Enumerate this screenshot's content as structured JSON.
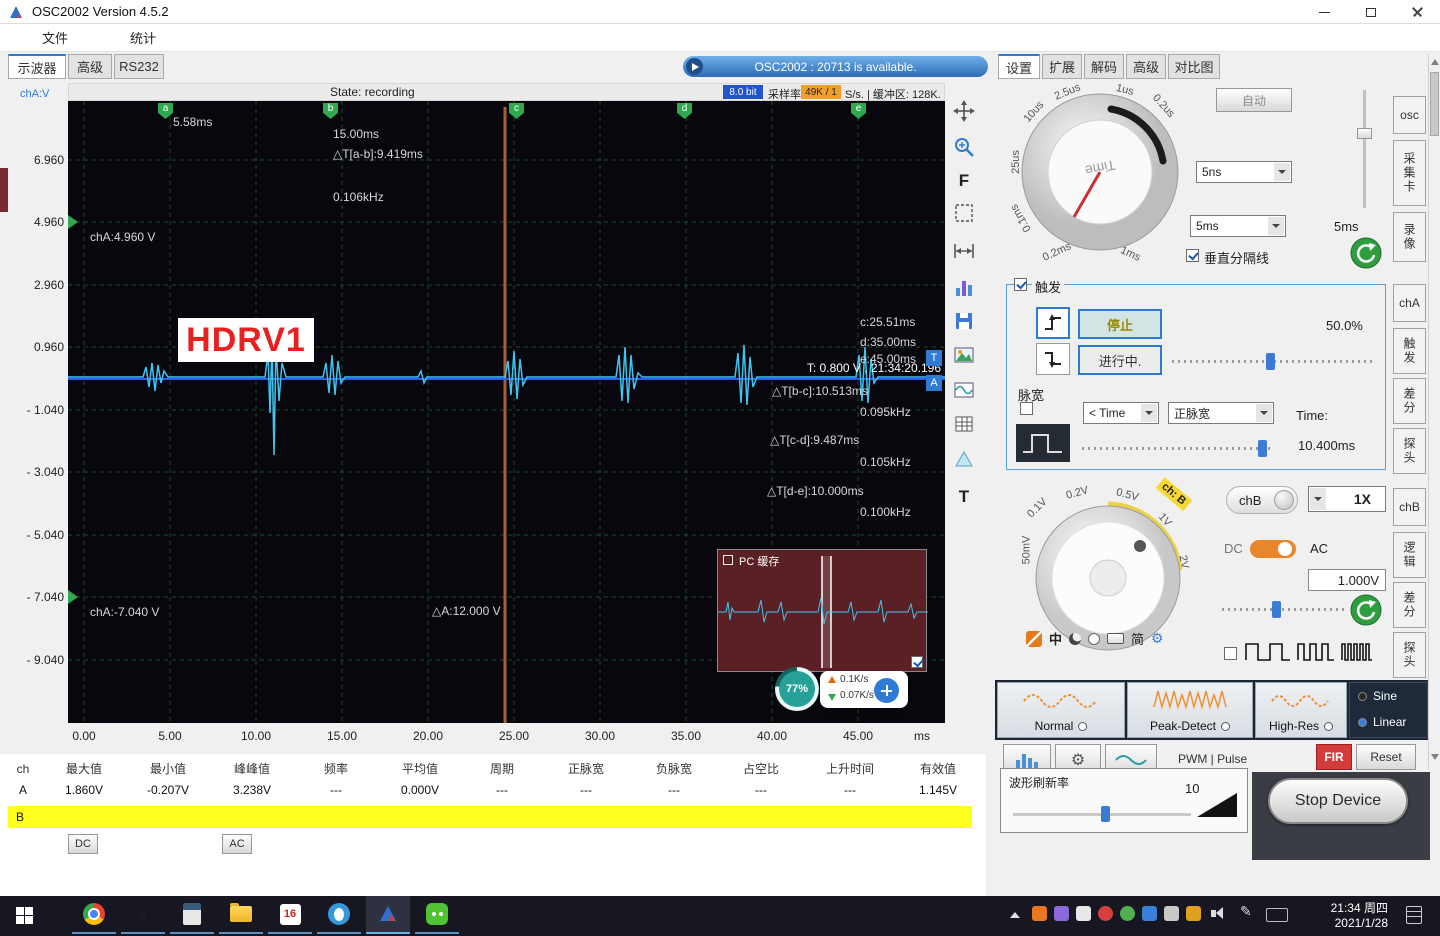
{
  "window": {
    "title": "OSC2002  Version 4.5.2"
  },
  "menubar": {
    "file": "文件",
    "stats": "统计"
  },
  "tabs": {
    "scope": "示波器",
    "advanced": "高级",
    "rs232": "RS232"
  },
  "notification": {
    "text": "OSC2002 : 20713 is available."
  },
  "colors": {
    "accent_blue": "#2e7bd6",
    "waveform_cyan": "#3fc6f0",
    "grid_green": "#1d4d2a",
    "marker_green": "#2fa84f",
    "buffer_maroon": "#5a2026",
    "highlight_yellow": "#ffff1e",
    "badge_orange": "#f0a028",
    "fir_red": "#d43c3c"
  },
  "scope": {
    "state": "State: recording",
    "bits_badge": "8.0 bit",
    "rate_label": "采样率",
    "rate_badge": "49K / 1",
    "rate_suffix": "S/s. | 缓冲区: 128K.",
    "ch_axis": "chA:V",
    "y_ticks": [
      "6.960",
      "4.960",
      "2.960",
      "0.960",
      "- 1.040",
      "- 3.040",
      "- 5.040",
      "- 7.040",
      "- 9.040"
    ],
    "x_ticks": [
      "0.00",
      "5.00",
      "10.00",
      "15.00",
      "20.00",
      "25.00",
      "30.00",
      "35.00",
      "40.00",
      "45.00"
    ],
    "x_unit": "ms",
    "markers": [
      "a",
      "b",
      "c",
      "d",
      "e"
    ],
    "ann": {
      "a_time": "5.58ms",
      "b_time": "15.00ms",
      "dt_ab": "△T[a-b]:9.419ms",
      "f_ab": "0.106kHz",
      "c_time": "c:25.51ms",
      "d_time": "d:35.00ms",
      "e_time": "e:45.00ms",
      "trig": "T: 0.800 V , 21:34:20.196",
      "dt_bc": "△T[b-c]:10.513ms",
      "f_bc": "0.095kHz",
      "dt_cd": "△T[c-d]:9.487ms",
      "f_cd": "0.105kHz",
      "dt_de": "△T[d-e]:10.000ms",
      "f_de": "0.100kHz",
      "ch_top": "chA:4.960 V",
      "ch_bot": "chA:-7.040 V",
      "delta_a": "△A:12.000 V",
      "overlay": "HDRV1",
      "t_flag": "T",
      "a_flag": "A"
    },
    "pc_buffer_label": "PC 缓存",
    "progress": "77%",
    "up_rate": "0.1K/s",
    "down_rate": "0.07K/s"
  },
  "side_toolbar": {
    "f_label": "F",
    "t_label": "T"
  },
  "panel": {
    "tabs": [
      "设置",
      "扩展",
      "解码",
      "高级",
      "对比图"
    ],
    "time": {
      "knob": "Time",
      "ticks": [
        "25us",
        "10us",
        "2.5us",
        "1us",
        "0.2us",
        "0.1ms",
        "0.2ms",
        "1ms"
      ],
      "auto": "自动",
      "dd1": "5ns",
      "dd2": "5ms",
      "range": "5ms",
      "vsep": "垂直分隔线"
    },
    "trigger": {
      "title": "触发",
      "stop": "停止",
      "running": "进行中.",
      "level": "50.0%",
      "pulse": "脉宽",
      "dd_time": "< Time",
      "dd_pol": "正脉宽",
      "time_label": "Time:",
      "time_value": "10.400ms"
    },
    "chb": {
      "tag": "ch: B",
      "button": "chB",
      "probe": "1X",
      "dc": "DC",
      "ac": "AC",
      "offset": "1.000V",
      "ticks": [
        "50mV",
        "0.1V",
        "0.2V",
        "0.5V",
        "1V",
        "2V"
      ]
    },
    "ime": {
      "zh": "中",
      "jian": "简"
    },
    "modes": {
      "normal": "Normal",
      "peak": "Peak-Detect",
      "highres": "High-Res",
      "sine": "Sine",
      "linear": "Linear"
    },
    "extra": {
      "pwm": "PWM | Pulse",
      "fir": "FIR",
      "reset": "Reset"
    },
    "refresh": {
      "title": "波形刷新率",
      "value": "10"
    },
    "stop_device": "Stop Device"
  },
  "strip": {
    "items": [
      "osc",
      "采集卡",
      "录像",
      "chA",
      "触发",
      "差分",
      "探头",
      "chB",
      "逻辑",
      "差分",
      "探头"
    ]
  },
  "table": {
    "headers": [
      "ch",
      "最大值",
      "最小值",
      "峰峰值",
      "频率",
      "平均值",
      "周期",
      "正脉宽",
      "负脉宽",
      "占空比",
      "上升时间",
      "有效值"
    ],
    "row_a": [
      "A",
      "1.860V",
      "-0.207V",
      "3.238V",
      "---",
      "0.000V",
      "---",
      "---",
      "---",
      "---",
      "---",
      "1.145V"
    ],
    "row_b": "B",
    "dc": "DC",
    "ac": "AC"
  },
  "taskbar": {
    "time": "21:34 周四",
    "date": "2021/1/28"
  }
}
